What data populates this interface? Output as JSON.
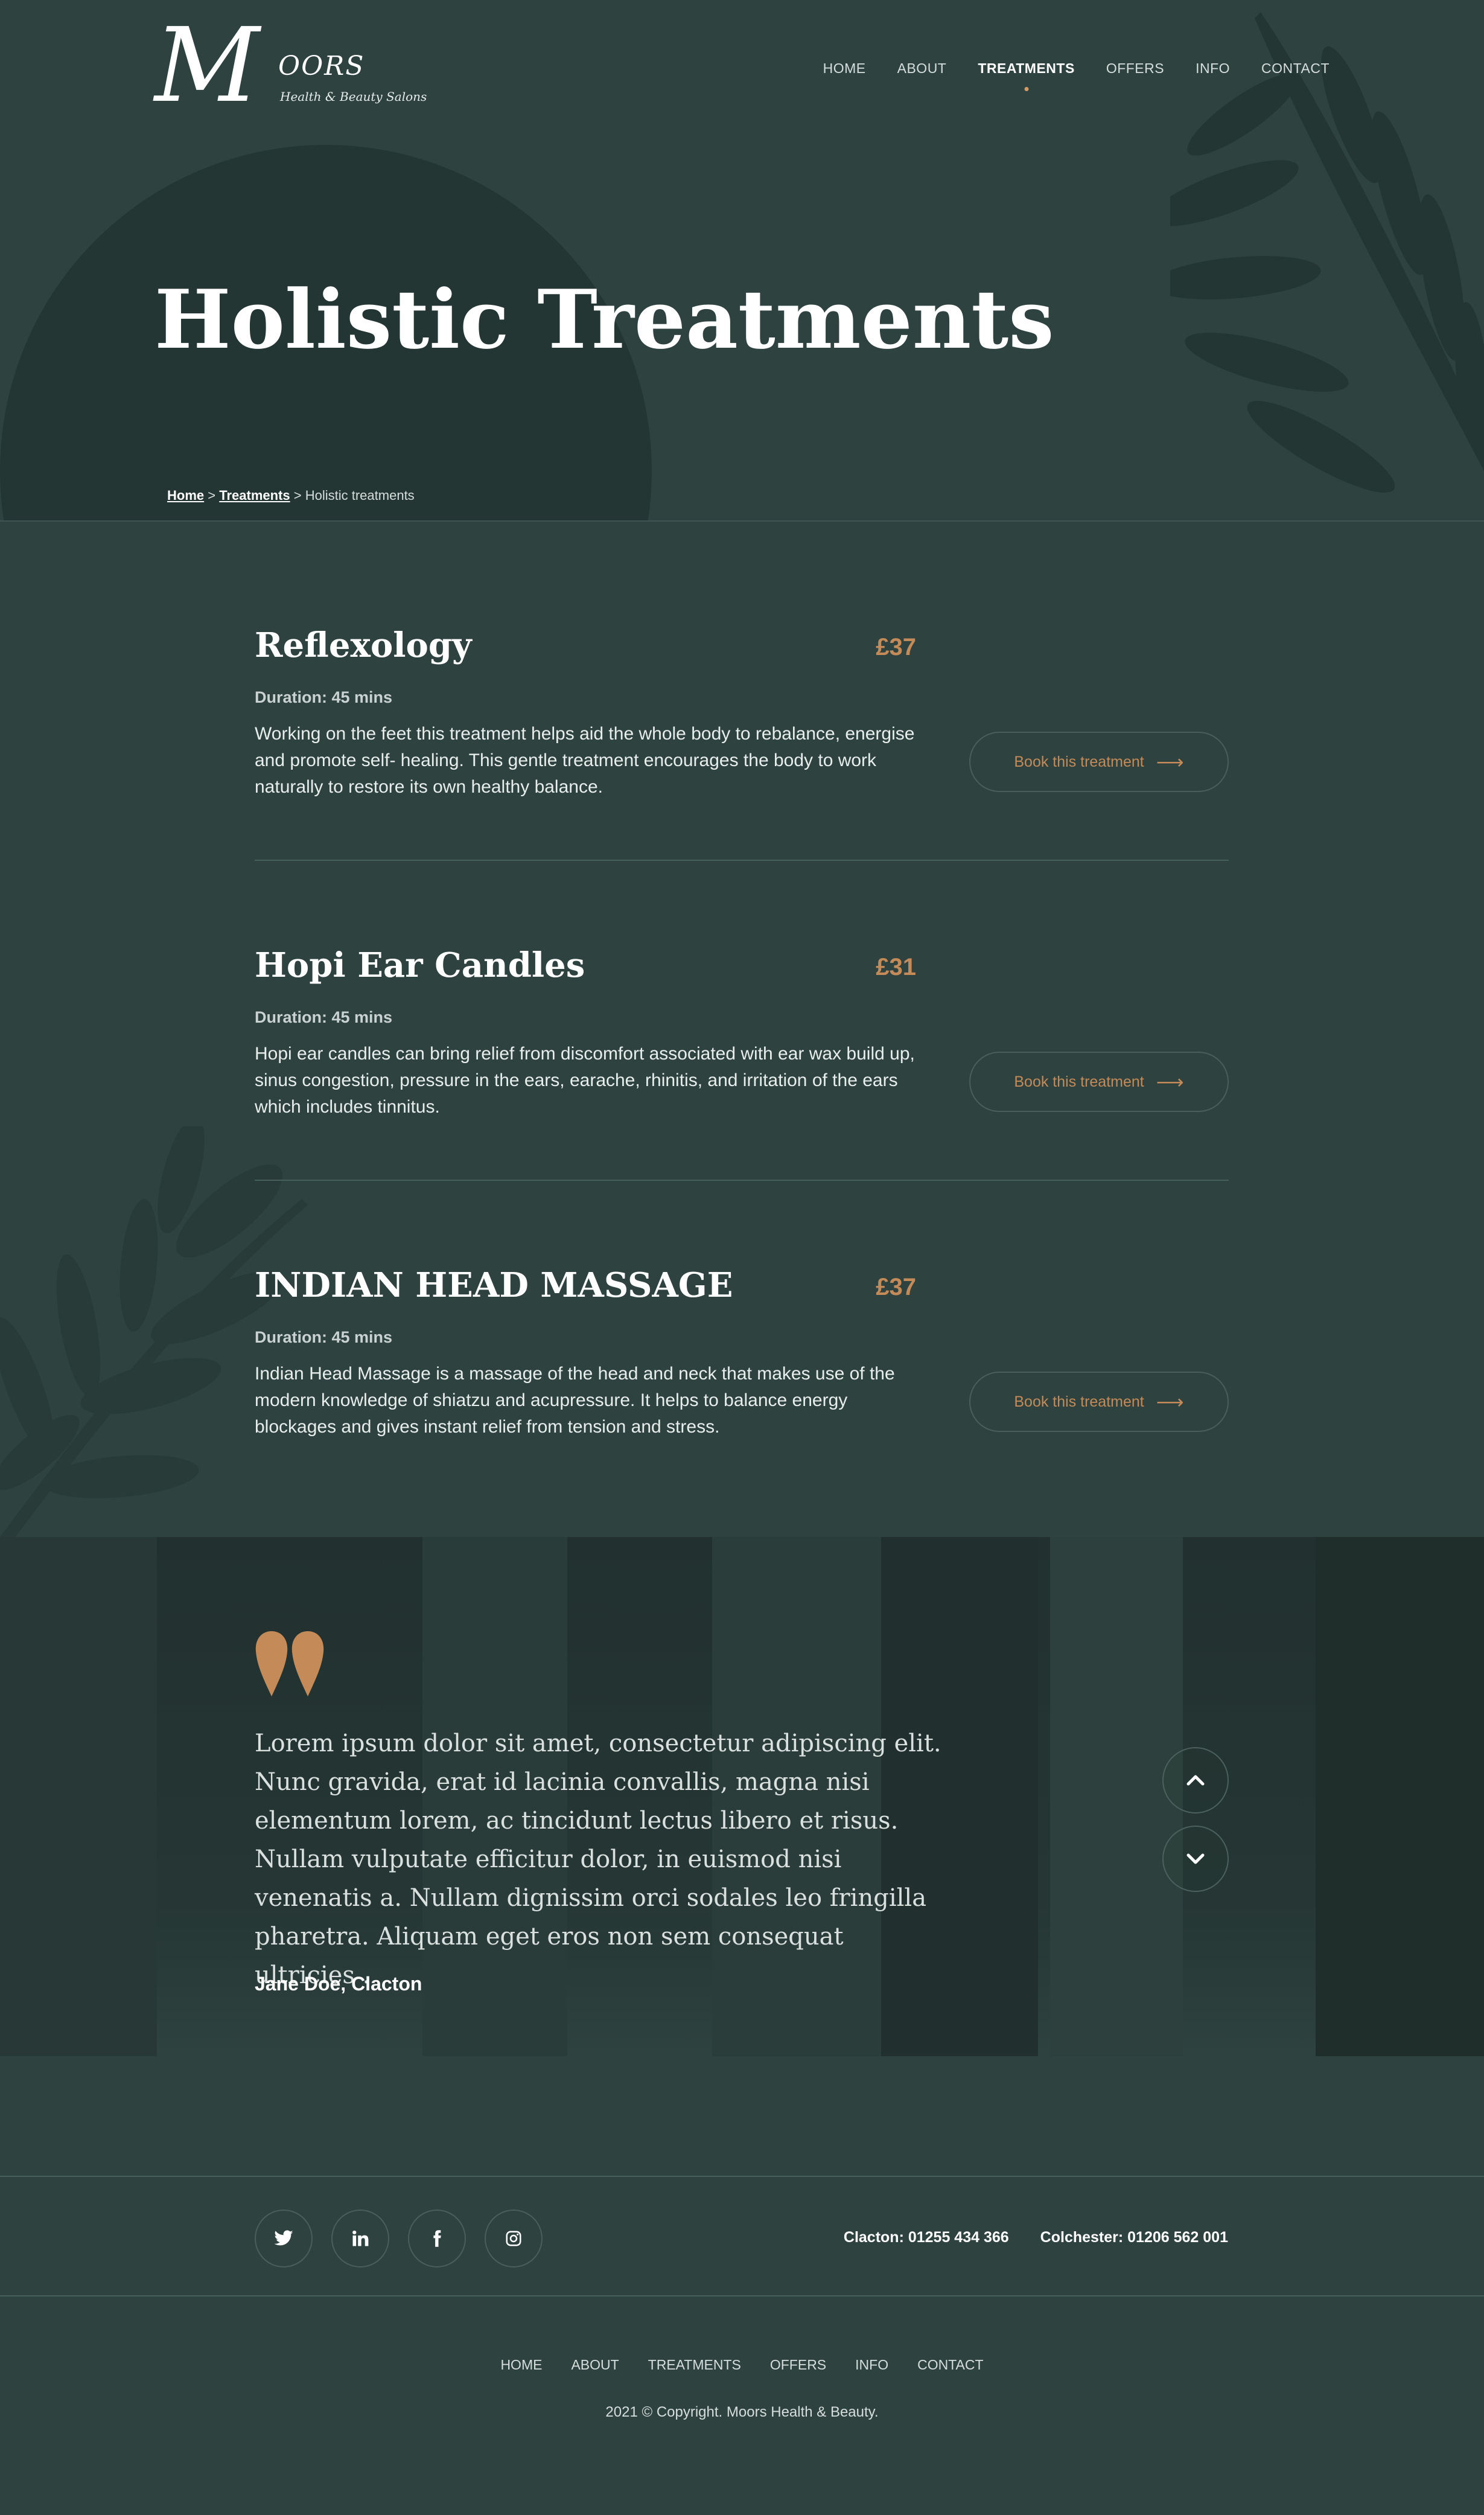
{
  "brand": {
    "logo_letter": "M",
    "logo_name": "OORS",
    "logo_tagline": "Health & Beauty Salons"
  },
  "nav": {
    "items": [
      {
        "label": "HOME"
      },
      {
        "label": "ABOUT"
      },
      {
        "label": "TREATMENTS"
      },
      {
        "label": "OFFERS"
      },
      {
        "label": "INFO"
      },
      {
        "label": "CONTACT"
      }
    ],
    "active": "TREATMENTS"
  },
  "hero": {
    "title": "Holistic Treatments"
  },
  "breadcrumb": {
    "home": "Home",
    "sep1": ">",
    "treatments": "Treatments",
    "sep2": ">",
    "current": "Holistic treatments"
  },
  "treatments": [
    {
      "title": "Reflexology",
      "price": "£37",
      "duration": "Duration: 45 mins",
      "description": "Working on the feet this treatment helps aid the whole body to rebalance, energise and promote self- healing. This gentle treatment encourages the body to work naturally to restore its own healthy balance.",
      "button": "Book this treatment"
    },
    {
      "title": "Hopi Ear Candles",
      "price": "£31",
      "duration": "Duration: 45 mins",
      "description": "Hopi ear candles can bring relief from discomfort associated with ear wax build up, sinus congestion, pressure in the ears, earache, rhinitis, and irritation of the ears which includes tinnitus.",
      "button": "Book this treatment"
    },
    {
      "title": "INDIAN HEAD MASSAGE",
      "price": "£37",
      "duration": "Duration: 45 mins",
      "description": "Indian Head Massage is a massage of the head and neck that makes use of the modern knowledge of shiatzu and acupressure. It helps to balance energy blockages and gives instant relief from tension and stress.",
      "button": "Book this treatment"
    }
  ],
  "testimonial": {
    "quote": "Lorem ipsum dolor sit amet, consectetur adipiscing elit. Nunc gravida, erat id lacinia convallis, magna nisi elementum lorem, ac tincidunt lectus libero et risus. Nullam vulputate efficitur dolor, in euismod nisi venenatis a. Nullam dignissim orci sodales leo fringilla pharetra. Aliquam eget eros non sem consequat ultricies .",
    "author": "Jane Doe, Clacton"
  },
  "footer": {
    "social": [
      {
        "icon": "twitter-icon"
      },
      {
        "icon": "linkedin-icon"
      },
      {
        "icon": "facebook-icon"
      },
      {
        "icon": "instagram-icon"
      }
    ],
    "phones": [
      {
        "text": "Clacton: 01255 434 366"
      },
      {
        "text": "Colchester: 01206 562 001"
      }
    ],
    "nav": [
      {
        "label": "HOME"
      },
      {
        "label": "ABOUT"
      },
      {
        "label": "TREATMENTS"
      },
      {
        "label": "OFFERS"
      },
      {
        "label": "INFO"
      },
      {
        "label": "CONTACT"
      }
    ],
    "copyright": "2021 © Copyright. Moors Health & Beauty."
  },
  "colors": {
    "background": "#2e4240",
    "accent": "#c48a57",
    "divider": "#46605b"
  }
}
